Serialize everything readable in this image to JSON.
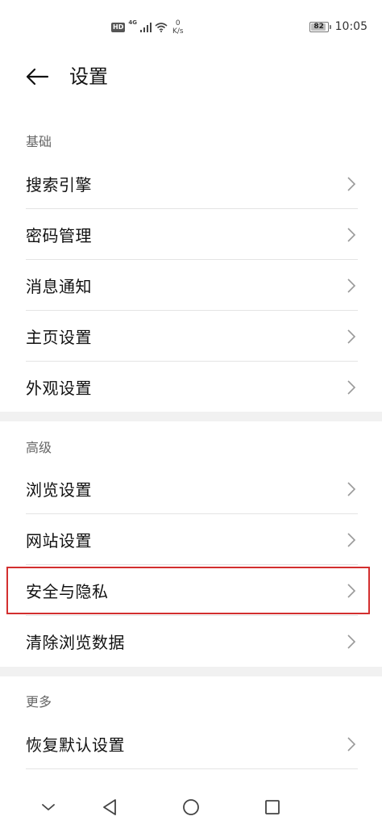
{
  "status_bar": {
    "hd": "HD",
    "network": "4G",
    "speed_value": "0",
    "speed_unit": "K/s",
    "battery": "82",
    "time": "10:05"
  },
  "header": {
    "back_icon": "arrow-left-icon",
    "title": "设置"
  },
  "sections": {
    "basic": {
      "title": "基础",
      "items": [
        {
          "label": "搜索引擎"
        },
        {
          "label": "密码管理"
        },
        {
          "label": "消息通知"
        },
        {
          "label": "主页设置"
        },
        {
          "label": "外观设置"
        }
      ]
    },
    "advanced": {
      "title": "高级",
      "items": [
        {
          "label": "浏览设置"
        },
        {
          "label": "网站设置"
        },
        {
          "label": "安全与隐私",
          "highlighted": true
        },
        {
          "label": "清除浏览数据"
        }
      ]
    },
    "more": {
      "title": "更多",
      "items": [
        {
          "label": "恢复默认设置"
        }
      ]
    }
  },
  "nav_bar": {
    "icons": [
      "chevron-down-icon",
      "back-triangle-icon",
      "home-circle-icon",
      "recents-square-icon"
    ]
  },
  "colors": {
    "highlight_border": "#d32f2f",
    "section_band": "#f1f1f1",
    "divider": "#e4e4e4"
  }
}
